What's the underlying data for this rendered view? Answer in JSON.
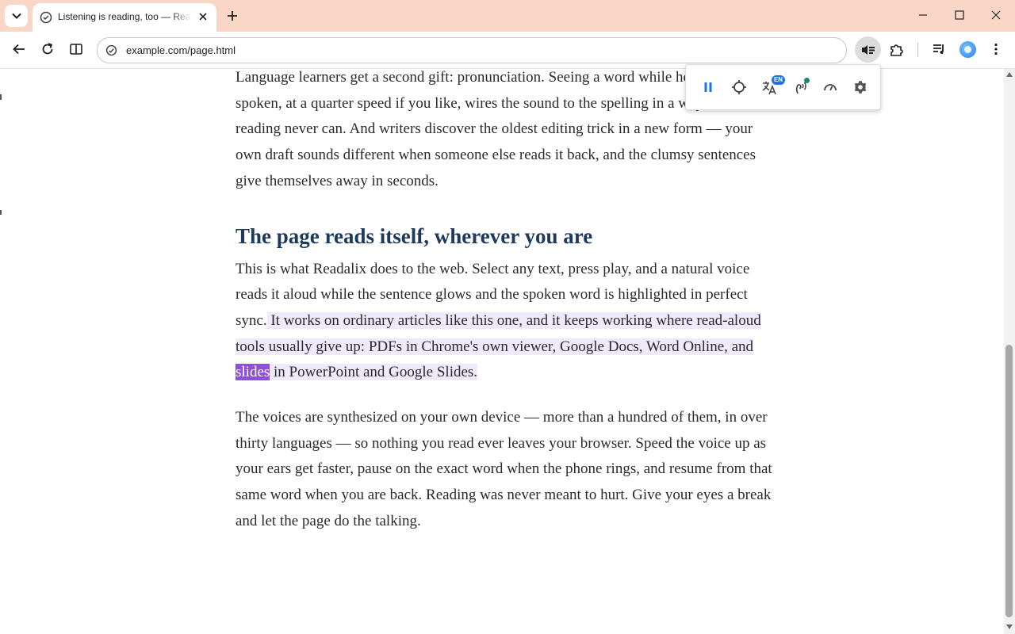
{
  "tab": {
    "title": "Listening is reading, too — Readalix"
  },
  "omnibox": {
    "url": "example.com/page.html"
  },
  "colors": {
    "titlebar": "#fad6c6",
    "heading": "#1d3a5c",
    "sentence_highlight": "#efe9fc",
    "word_highlight": "#8e4ee0",
    "accent": "#1a73e8",
    "reader_pointer": "#16857c"
  },
  "player": {
    "language_badge": "EN"
  },
  "article": {
    "p1": "Language learners get a second gift: pronunciation. Seeing a word while hearing it spoken, at a quarter speed if you like, wires the sound to the spelling in a way silent reading never can. And writers discover the oldest editing trick in a new form — your own draft sounds different when someone else reads it back, and the clumsy sentences give themselves away in seconds.",
    "heading": "The page reads itself, wherever you are",
    "p2_plain": "This is what Readalix does to the web. Select any text, press play, and a natural voice reads it aloud while the sentence glows and the spoken word is highlighted in perfect sync.",
    "p2_hl_before": " It works on ordinary articles like this one, and it keeps working where read-aloud tools usually give up: PDFs in Chrome's own viewer, Google Docs, Word Online, and ",
    "p2_hl_word": "slides",
    "p2_hl_after": " in PowerPoint and Google Slides.",
    "p3": "The voices are synthesized on your own device — more than a hundred of them, in over thirty languages — so nothing you read ever leaves your browser. Speed the voice up as your ears get faster, pause on the exact word when the phone rings, and resume from that same word when you are back. Reading was never meant to hurt. Give your eyes a break and let the page do the talking."
  }
}
